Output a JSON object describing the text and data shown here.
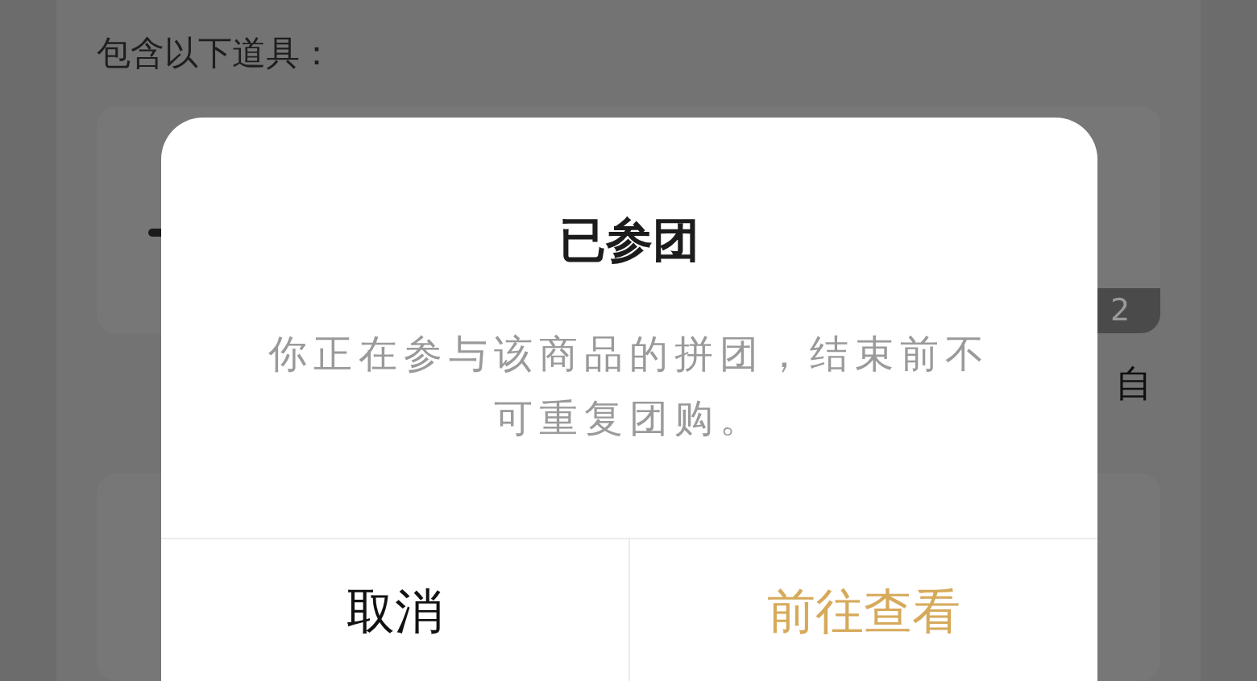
{
  "page": {
    "section_title": "包含以下道具：",
    "items": [
      {
        "badge": "2",
        "caption": "自"
      }
    ]
  },
  "dialog": {
    "title": "已参团",
    "message": "你正在参与该商品的拼团，结束前不可重复团购。",
    "buttons": [
      {
        "label": "取消",
        "kind": "cancel"
      },
      {
        "label": "前往查看",
        "kind": "primary"
      }
    ]
  }
}
